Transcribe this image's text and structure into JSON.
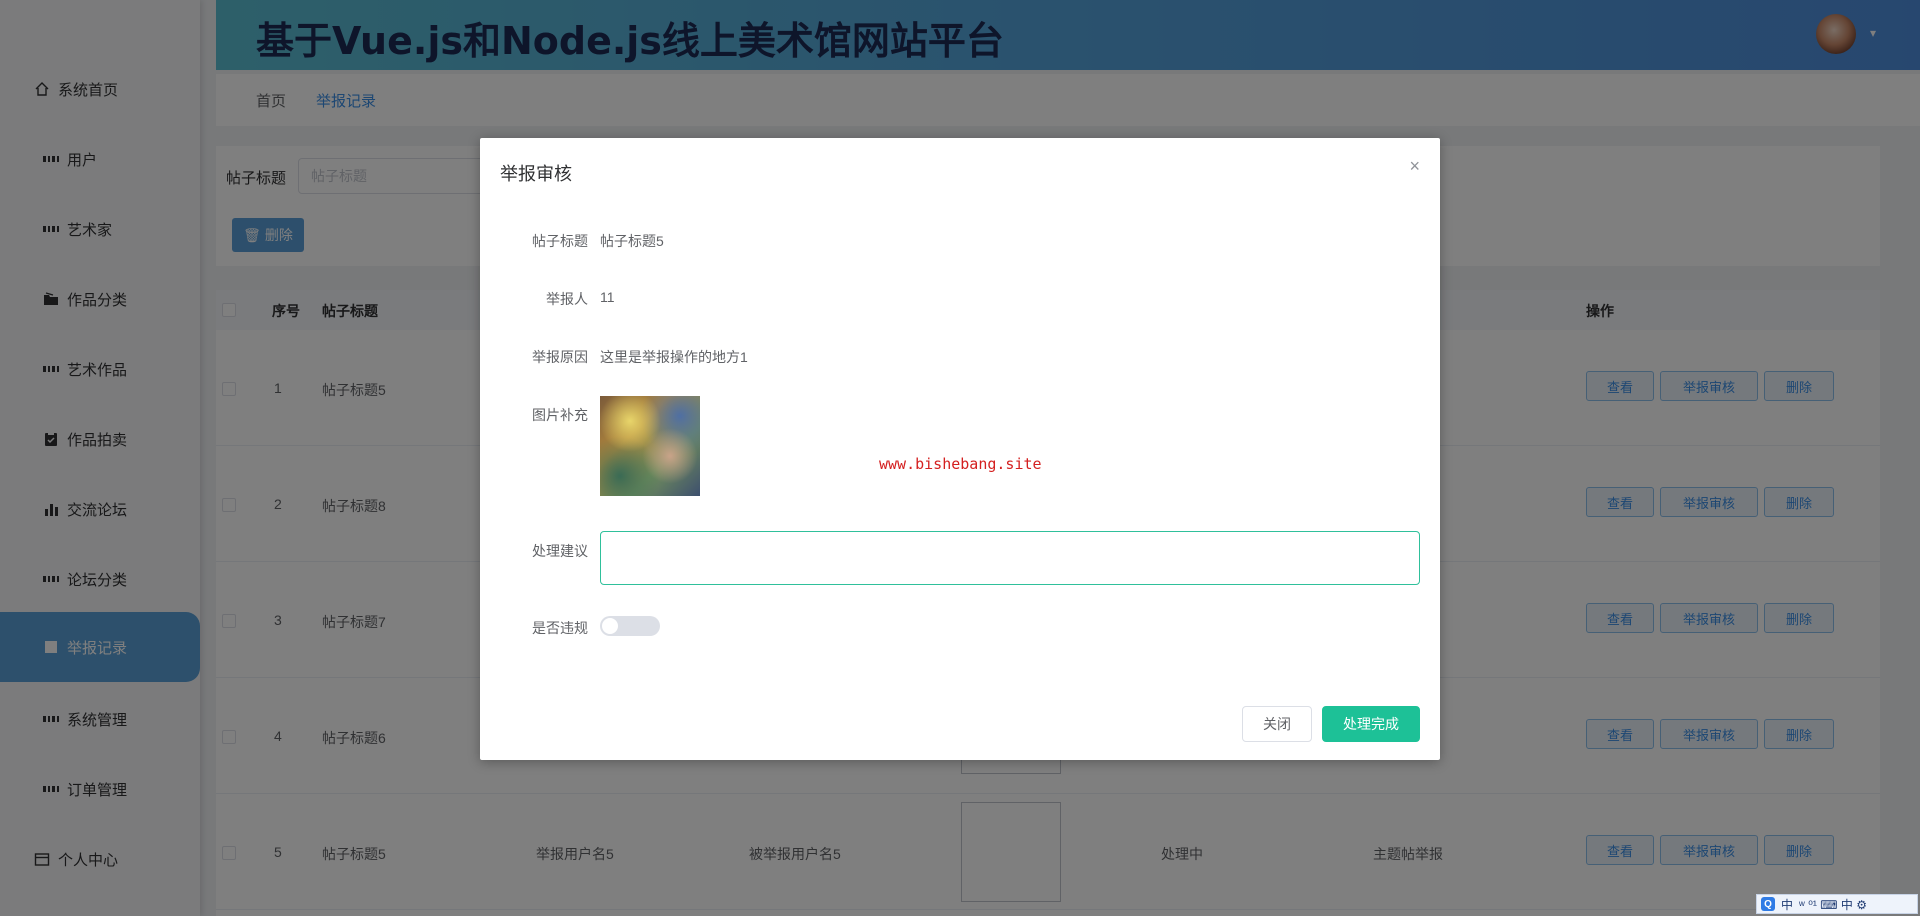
{
  "header": {
    "title": "基于Vue.js和Node.js线上美术馆网站平台",
    "avatar_caret": "▾"
  },
  "sidebar": {
    "items": [
      {
        "label": "系统首页",
        "icon": "home-icon"
      },
      {
        "label": "用户",
        "icon": "grid-icon"
      },
      {
        "label": "艺术家",
        "icon": "grid-icon"
      },
      {
        "label": "作品分类",
        "icon": "folder-icon"
      },
      {
        "label": "艺术作品",
        "icon": "grid-icon"
      },
      {
        "label": "作品拍卖",
        "icon": "clipboard-icon"
      },
      {
        "label": "交流论坛",
        "icon": "bar-chart-icon"
      },
      {
        "label": "论坛分类",
        "icon": "grid-icon"
      },
      {
        "label": "举报记录",
        "icon": "document-icon",
        "active": true
      },
      {
        "label": "系统管理",
        "icon": "grid-icon"
      },
      {
        "label": "订单管理",
        "icon": "grid-icon"
      },
      {
        "label": "个人中心",
        "icon": "calendar-icon"
      }
    ]
  },
  "breadcrumb": {
    "home": "首页",
    "current": "举报记录"
  },
  "search": {
    "label": "帖子标题",
    "placeholder": "帖子标题",
    "delete_label": "删除"
  },
  "table": {
    "columns": {
      "index": "序号",
      "title": "帖子标题",
      "actions": "操作"
    },
    "rows": [
      {
        "index": "1",
        "title": "帖子标题5"
      },
      {
        "index": "2",
        "title": "帖子标题8"
      },
      {
        "index": "3",
        "title": "帖子标题7"
      },
      {
        "index": "4",
        "title": "帖子标题6"
      },
      {
        "index": "5",
        "title": "帖子标题5",
        "reporter": "举报用户名5",
        "reported": "被举报用户名5",
        "status": "处理中",
        "type": "主题帖举报"
      }
    ],
    "actions": {
      "view": "查看",
      "review": "举报审核",
      "delete": "删除"
    }
  },
  "dialog": {
    "title": "举报审核",
    "close_glyph": "×",
    "fields": {
      "post_title_label": "帖子标题",
      "post_title_value": "帖子标题5",
      "reporter_label": "举报人",
      "reporter_value": "11",
      "reason_label": "举报原因",
      "reason_value": "这里是举报操作的地方1",
      "image_label": "图片补充",
      "suggestion_label": "处理建议",
      "suggestion_value": "",
      "violation_label": "是否违规",
      "violation_value": false
    },
    "watermark": "www.bishebang.site",
    "buttons": {
      "close": "关闭",
      "done": "处理完成"
    }
  },
  "ime": {
    "badge": "Q",
    "mode": "中",
    "tail": "ʷ ⁰¹ ⌨ 中 ⚙"
  },
  "colors": {
    "accent": "#1dc197",
    "primary": "#3a8ee6",
    "sidebar_active": "#5ba1d8",
    "watermark": "#d42020"
  }
}
